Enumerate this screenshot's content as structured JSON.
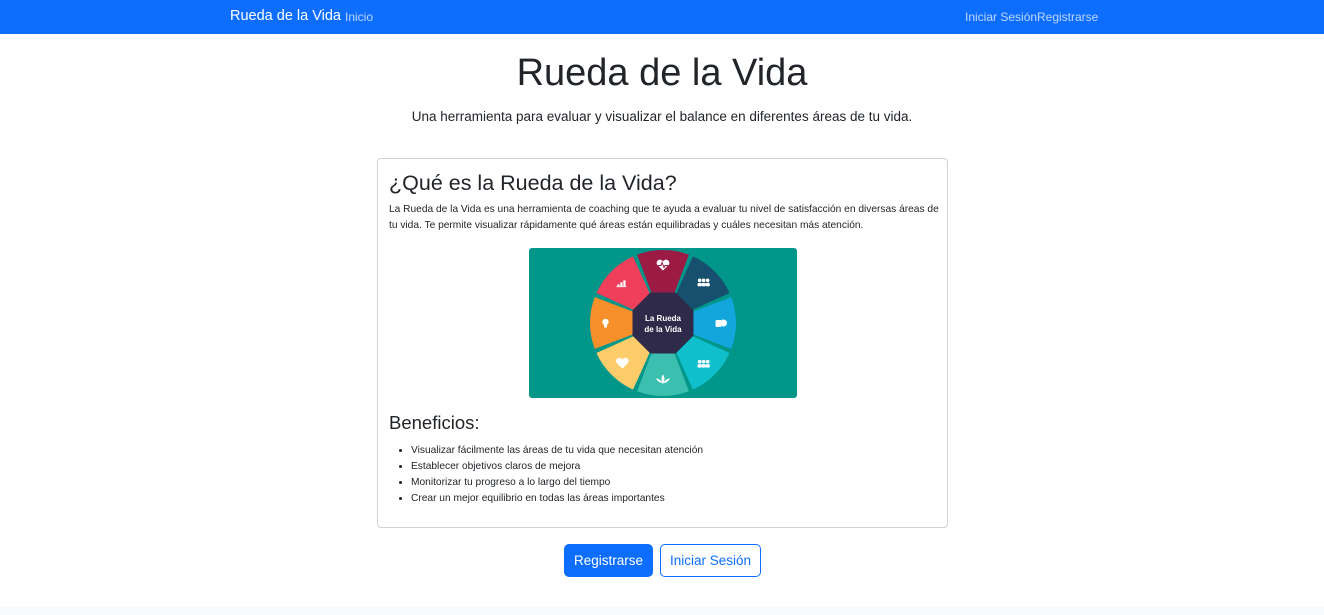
{
  "navbar": {
    "brand": "Rueda de la Vida",
    "links": [
      {
        "label": "Inicio"
      },
      {
        "label": "Iniciar Sesión"
      },
      {
        "label": "Registrarse"
      }
    ]
  },
  "hero": {
    "title": "Rueda de la Vida",
    "subtitle": "Una herramienta para evaluar y visualizar el balance en diferentes áreas de tu vida."
  },
  "card": {
    "title": "¿Qué es la Rueda de la Vida?",
    "description": "La Rueda de la Vida es una herramienta de coaching que te ayuda a evaluar tu nivel de satisfacción en diversas áreas de tu vida. Te permite visualizar rápidamente qué áreas están equilibradas y cuáles necesitan más atención.",
    "wheel_image": {
      "center_line1": "La Rueda",
      "center_line2": "de la Vida",
      "segments": [
        {
          "icon": "heart-pulse-icon",
          "color": "#9b1b45"
        },
        {
          "icon": "people-icon",
          "color": "#16506e"
        },
        {
          "icon": "coins-icon",
          "color": "#12a6dc"
        },
        {
          "icon": "group-icon",
          "color": "#0fbfcb"
        },
        {
          "icon": "lotus-icon",
          "color": "#3bbfae"
        },
        {
          "icon": "heart-icon",
          "color": "#fccc6a"
        },
        {
          "icon": "lightbulb-icon",
          "color": "#f7902a"
        },
        {
          "icon": "chart-icon",
          "color": "#ef3f5a"
        }
      ],
      "background": "#00968a",
      "center_color": "#2f2a4a"
    },
    "benefits_title": "Beneficios:",
    "benefits": [
      "Visualizar fácilmente las áreas de tu vida que necesitan atención",
      "Establecer objetivos claros de mejora",
      "Monitorizar tu progreso a lo largo del tiempo",
      "Crear un mejor equilibrio en todas las áreas importantes"
    ]
  },
  "actions": {
    "register_label": "Registrarse",
    "login_label": "Iniciar Sesión"
  },
  "colors": {
    "primary": "#0d6efd",
    "text": "#212529"
  }
}
